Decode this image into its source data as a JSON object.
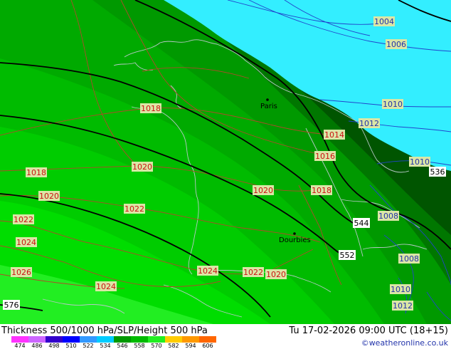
{
  "map": {
    "fill_colors": {
      "sea_cyan": "#33eeff",
      "thickness_546": "#00aa00",
      "thickness_540": "#009900",
      "thickness_534": "#007700",
      "thickness_528": "#005500",
      "thickness_552": "#00bb00",
      "thickness_558": "#00cc00",
      "thickness_564": "#00dd00",
      "thickness_570": "#22ee22"
    },
    "isobar_labels": [
      "1004",
      "1006",
      "1010",
      "1012",
      "1010",
      "1008",
      "1008",
      "1010",
      "1012",
      "1014",
      "1016",
      "1018",
      "1018",
      "1018",
      "1020",
      "1020",
      "1020",
      "1020",
      "1022",
      "1022",
      "1022",
      "1024",
      "1024",
      "1024",
      "1026"
    ],
    "height_labels": [
      "536",
      "544",
      "552",
      "576"
    ],
    "cities": [
      {
        "name": "Paris"
      },
      {
        "name": "Dourbies"
      }
    ]
  },
  "footer": {
    "title": "Thickness 500/1000 hPa/SLP/Height 500 hPa",
    "valid_time": "Tu 17-02-2026 09:00 UTC (18+15)",
    "copyright": "©weatheronline.co.uk",
    "scale_ticks": [
      "474",
      "486",
      "498",
      "510",
      "522",
      "534",
      "546",
      "558",
      "570",
      "582",
      "594",
      "606"
    ],
    "scale_colors": [
      "#ff33ff",
      "#cc66ff",
      "#3300cc",
      "#0000ff",
      "#3399ff",
      "#00ccff",
      "#009900",
      "#00bb00",
      "#22ee22",
      "#ffcc00",
      "#ff9900",
      "#ff6600"
    ]
  }
}
